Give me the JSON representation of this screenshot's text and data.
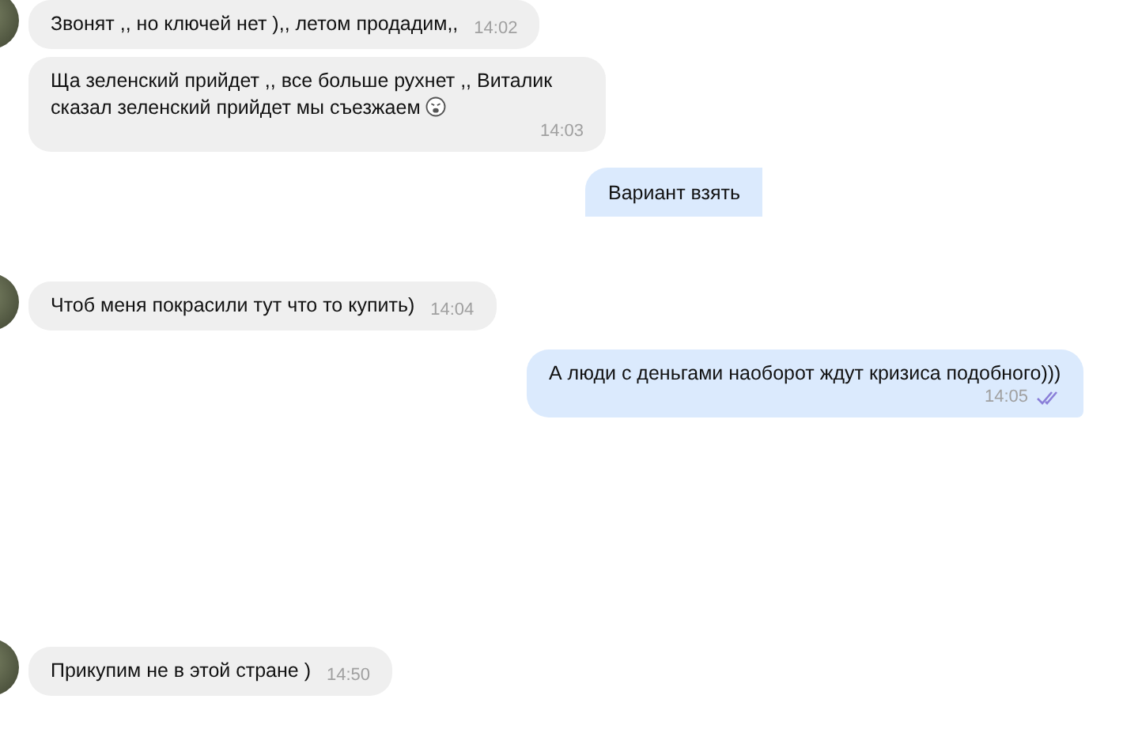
{
  "messages": [
    {
      "kind": "incoming",
      "avatar": true,
      "text": "Звонят ,, но ключей нет ),, летом продадим,,",
      "time": "14:02"
    },
    {
      "kind": "incoming",
      "text": "Ща зеленский прийдет ,, все больше рухнет ,, Виталик сказал зеленский прийдет мы съезжаем",
      "time": "14:03",
      "emoji": true
    },
    {
      "kind": "outgoing",
      "text": "Вариант взять"
    },
    {
      "kind": "incoming",
      "avatar": true,
      "text": "Чтоб меня покрасили тут что то купить)",
      "time": "14:04"
    },
    {
      "kind": "outgoing",
      "text": "А люди с деньгами наоборот ждут кризиса подобного)))",
      "time": "14:05",
      "read": true
    },
    {
      "kind": "incoming",
      "avatar": true,
      "text": "Прикупим не в этой стране )",
      "time": "14:50"
    }
  ]
}
